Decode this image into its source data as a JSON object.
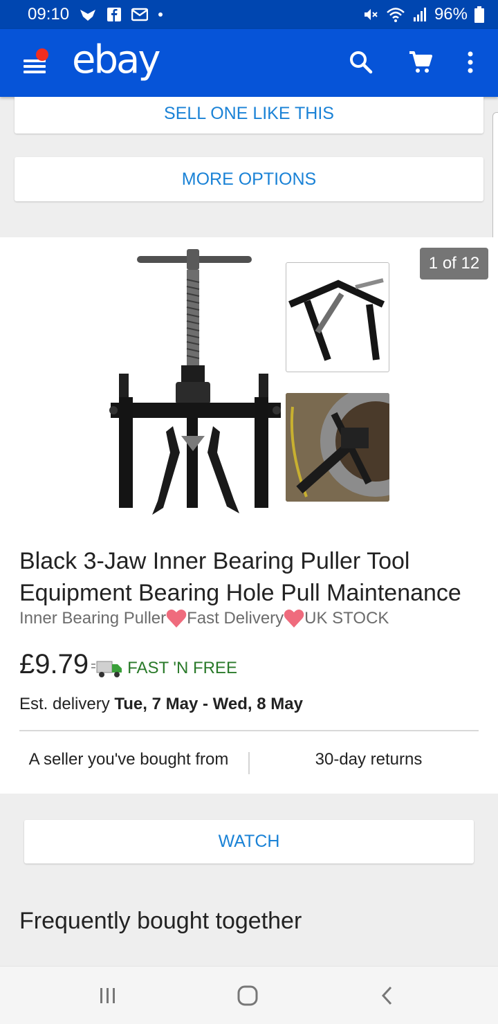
{
  "status_bar": {
    "time": "09:10",
    "battery": "96%"
  },
  "app_bar": {
    "logo": "ebay"
  },
  "actions": {
    "sell_one_like_this": "SELL ONE LIKE THIS",
    "more_options": "MORE OPTIONS",
    "watch": "WATCH"
  },
  "gallery": {
    "counter": "1 of 12"
  },
  "listing": {
    "title": "Black 3-Jaw Inner Bearing Puller Tool Equipment  Bearing Hole Pull Maintenance",
    "subtitle_parts": [
      "Inner Bearing Puller",
      "Fast Delivery",
      "UK STOCK"
    ],
    "price": "£9.79",
    "shipping": "FAST 'N FREE",
    "delivery_label": "Est. delivery",
    "delivery_dates": "Tue, 7 May - Wed, 8 May",
    "badges": [
      "A seller you've bought from",
      "30-day returns"
    ]
  },
  "sections": {
    "frequently_bought": "Frequently bought together"
  },
  "colors": {
    "brand_blue": "#0654d8",
    "status_blue": "#0046b0",
    "link_blue": "#1a82d6",
    "shipping_green": "#2a7a2a",
    "notification_red": "#f02d1f"
  },
  "icons": {
    "status_left": [
      "wings-icon",
      "facebook-icon",
      "gmail-icon",
      "dot-icon"
    ],
    "status_right": [
      "mute-icon",
      "wifi-icon",
      "signal-icon",
      "battery-icon"
    ],
    "app_bar": [
      "menu-icon",
      "search-icon",
      "cart-icon",
      "more-vert-icon"
    ],
    "nav": [
      "recents-icon",
      "home-icon",
      "back-icon"
    ]
  }
}
